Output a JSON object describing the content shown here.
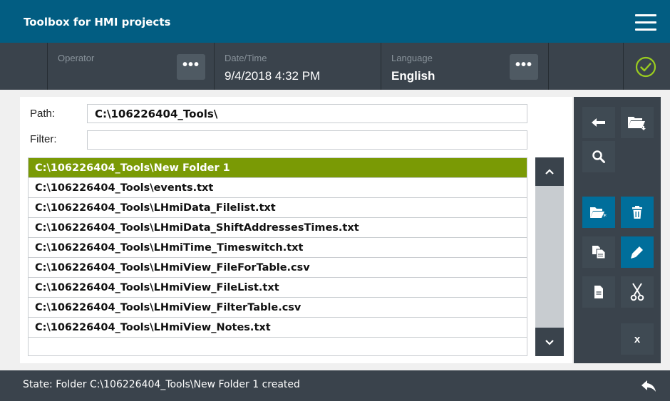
{
  "app": {
    "title": "Toolbox for HMI projects"
  },
  "status": {
    "operator_label": "Operator",
    "operator_value": "",
    "datetime_label": "Date/Time",
    "datetime_value": "9/4/2018 4:32 PM",
    "language_label": "Language",
    "language_value": "English",
    "more_label": "•••"
  },
  "form": {
    "path_label": "Path:",
    "path_value": "C:\\106226404_Tools\\",
    "filter_label": "Filter:",
    "filter_value": ""
  },
  "files": [
    "C:\\106226404_Tools\\New Folder 1",
    "C:\\106226404_Tools\\events.txt",
    "C:\\106226404_Tools\\LHmiData_Filelist.txt",
    "C:\\106226404_Tools\\LHmiData_ShiftAddressesTimes.txt",
    "C:\\106226404_Tools\\LHmiTime_Timeswitch.txt",
    "C:\\106226404_Tools\\LHmiView_FileForTable.csv",
    "C:\\106226404_Tools\\LHmiView_FileList.txt",
    "C:\\106226404_Tools\\LHmiView_FilterTable.csv",
    "C:\\106226404_Tools\\LHmiView_Notes.txt"
  ],
  "selected_file": "C:\\106226404_Tools\\New Folder 1",
  "side": {
    "close_label": "x"
  },
  "footer": {
    "state": "State: Folder C:\\106226404_Tools\\New Folder 1 created"
  },
  "colors": {
    "accent": "#025d82",
    "selection": "#7a9a05",
    "ok": "#9acc1f",
    "button_blue": "#006e9b"
  },
  "icons": [
    "menu-icon",
    "checkmark-circle-icon",
    "arrow-left-icon",
    "folder-down-icon",
    "search-icon",
    "new-folder-icon",
    "trash-icon",
    "copy-icon",
    "edit-icon",
    "document-icon",
    "cut-icon",
    "chevron-up-icon",
    "chevron-down-icon",
    "return-arrow-icon"
  ]
}
